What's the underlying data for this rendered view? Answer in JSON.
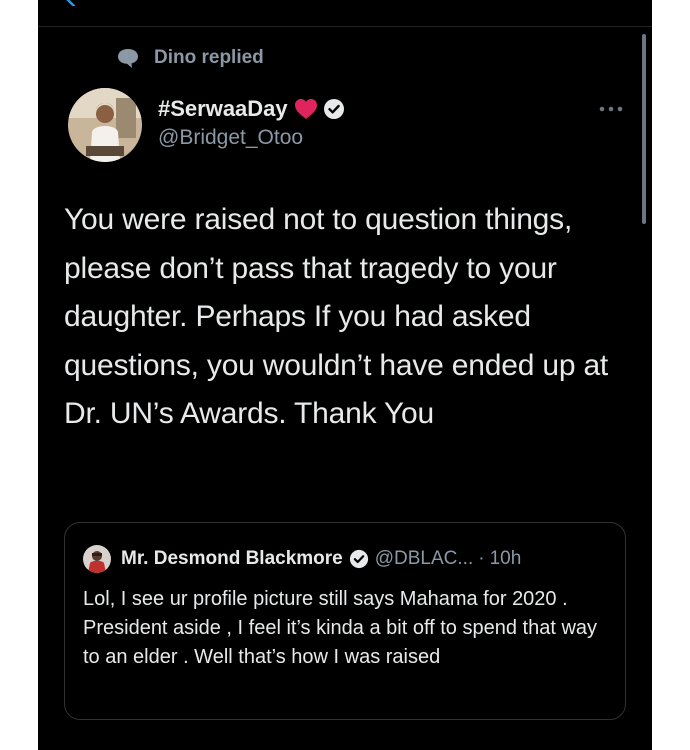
{
  "context": {
    "reply_label": "Dino replied"
  },
  "tweet": {
    "display_name": "#SerwaaDay",
    "handle": "@Bridget_Otoo",
    "text": "You were raised not to question things, please don’t pass that tragedy to your daughter. Perhaps If you had asked questions, you wouldn’t have ended up at Dr. UN’s Awards. Thank You"
  },
  "quoted_tweet": {
    "display_name": "Mr. Desmond Blackmore",
    "handle": "@DBLAC...",
    "separator": "·",
    "time": "10h",
    "text": "Lol, I see ur profile picture still says Mahama for 2020 . President aside , I feel it’s kinda a bit off to spend that way to an elder . Well that’s how I was raised"
  },
  "icons": {
    "back": "back-arrow-icon",
    "reply": "speech-bubble-icon",
    "heart": "red-heart-icon",
    "verified": "verified-badge-icon",
    "more": "more-options-icon"
  },
  "colors": {
    "background": "#000000",
    "text_primary": "#e7e9ea",
    "text_secondary": "#8b98a5",
    "heart": "#e0245e",
    "border": "#2f3336"
  }
}
